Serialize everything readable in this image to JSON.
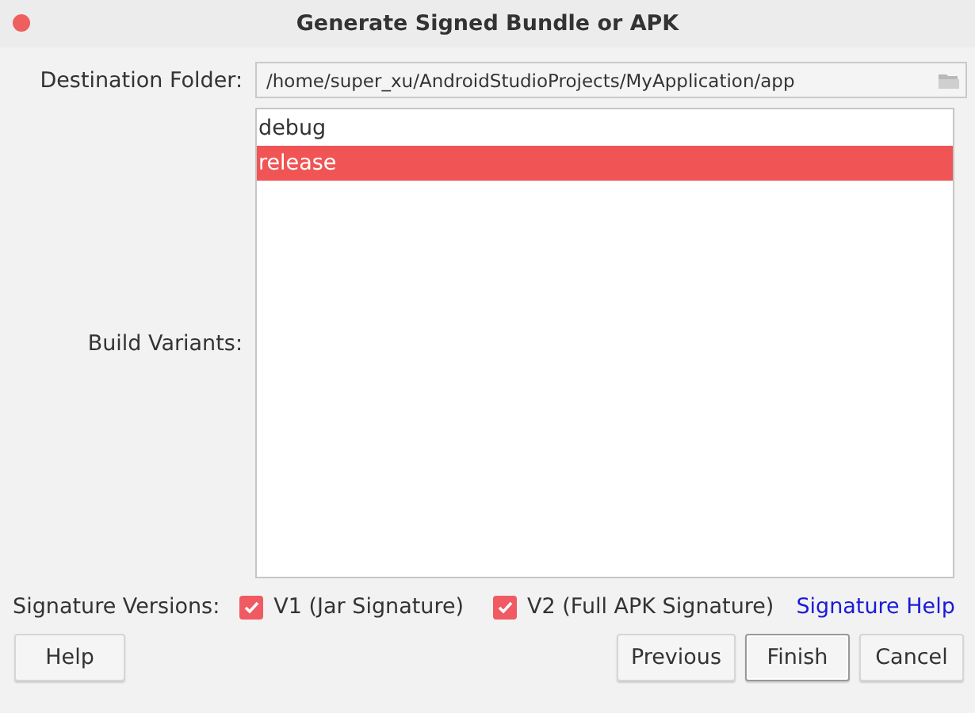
{
  "window": {
    "title": "Generate Signed Bundle or APK"
  },
  "destination": {
    "label": "Destination Folder:",
    "value": "/home/super_xu/AndroidStudioProjects/MyApplication/app"
  },
  "build_variants": {
    "label": "Build Variants:",
    "items": [
      {
        "label": "debug",
        "selected": false
      },
      {
        "label": "release",
        "selected": true
      }
    ]
  },
  "signature_versions": {
    "label": "Signature Versions:",
    "options": [
      {
        "label": "V1 (Jar Signature)",
        "checked": true
      },
      {
        "label": "V2 (Full APK Signature)",
        "checked": true
      }
    ],
    "help_link": "Signature Help"
  },
  "buttons": {
    "help": "Help",
    "actions": [
      {
        "label": "Previous",
        "default": false
      },
      {
        "label": "Finish",
        "default": true
      },
      {
        "label": "Cancel",
        "default": false
      }
    ]
  }
}
